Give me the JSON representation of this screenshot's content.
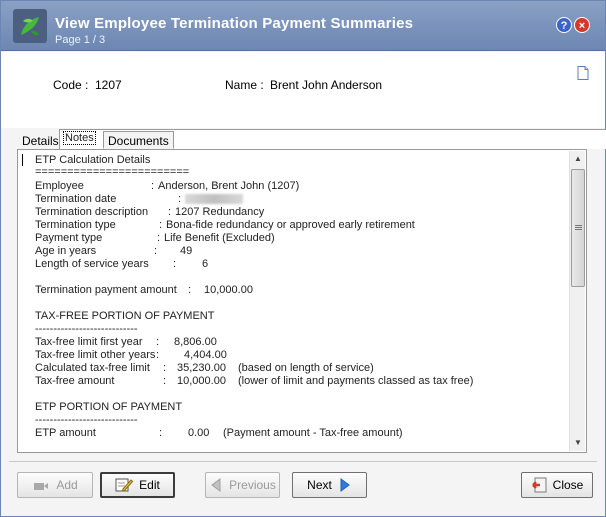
{
  "window": {
    "title": "View Employee Termination Payment Summaries",
    "subtitle": "Page 1 / 3",
    "help_glyph": "?",
    "close_glyph": "×"
  },
  "header": {
    "code_label": "Code :",
    "code_value": "1207",
    "name_label": "Name :",
    "name_value": "Brent John Anderson"
  },
  "tabs": [
    {
      "label": "Details"
    },
    {
      "label": "Notes"
    },
    {
      "label": "Documents"
    }
  ],
  "notes": {
    "heading": "ETP Calculation Details",
    "underline": "========================",
    "rows": [
      {
        "label": "Employee",
        "sep": ":",
        "value": "Anderson, Brent John (1207)"
      },
      {
        "label": "Termination date",
        "sep": ":",
        "value": ""
      },
      {
        "label": "Termination description",
        "sep": ":",
        "value": "1207 Redundancy"
      },
      {
        "label": "Termination type",
        "sep": ":",
        "value": "Bona-fide redundancy or approved early retirement"
      },
      {
        "label": "Payment type",
        "sep": ":",
        "value": "Life Benefit (Excluded)"
      },
      {
        "label": "Age in years",
        "sep": ":",
        "value": "49"
      },
      {
        "label": "Length of service years",
        "sep": ":",
        "value": "6"
      }
    ],
    "termination_amount": {
      "label": "Termination payment amount",
      "sep": ":",
      "value": "10,000.00"
    },
    "taxfree_heading": "TAX-FREE PORTION OF PAYMENT",
    "taxfree_underline": "----------------------------",
    "taxfree_rows": [
      {
        "label": "Tax-free limit first year",
        "sep": ":",
        "value": "8,806.00",
        "note": ""
      },
      {
        "label": "Tax-free limit other years",
        "sep": ":",
        "value": "4,404.00",
        "note": ""
      },
      {
        "label": "Calculated tax-free limit",
        "sep": ":",
        "value": "35,230.00",
        "note": "(based on length of service)"
      },
      {
        "label": "Tax-free amount",
        "sep": ":",
        "value": "10,000.00",
        "note": "(lower of limit and payments classed as tax free)"
      }
    ],
    "etp_heading": "ETP PORTION OF PAYMENT",
    "etp_underline": "----------------------------",
    "etp_row": {
      "label": "ETP amount",
      "sep": ":",
      "value": "0.00",
      "note": "(Payment amount - Tax-free amount)"
    }
  },
  "scrollbar": {
    "up": "▲",
    "down": "▼"
  },
  "buttons": {
    "add": "Add",
    "edit": "Edit",
    "previous": "Previous",
    "next": "Next",
    "close": "Close"
  },
  "icons": {
    "logo": "leaf-logo-icon",
    "document": "document-icon",
    "add": "add-user-icon",
    "edit": "edit-pencil-icon",
    "previous": "arrow-left-icon",
    "next": "arrow-right-icon",
    "close": "close-exit-icon"
  },
  "colors": {
    "titlebar": "#7a93bd",
    "accent_blue": "#2f7be0",
    "close_red": "#d33a2c"
  }
}
